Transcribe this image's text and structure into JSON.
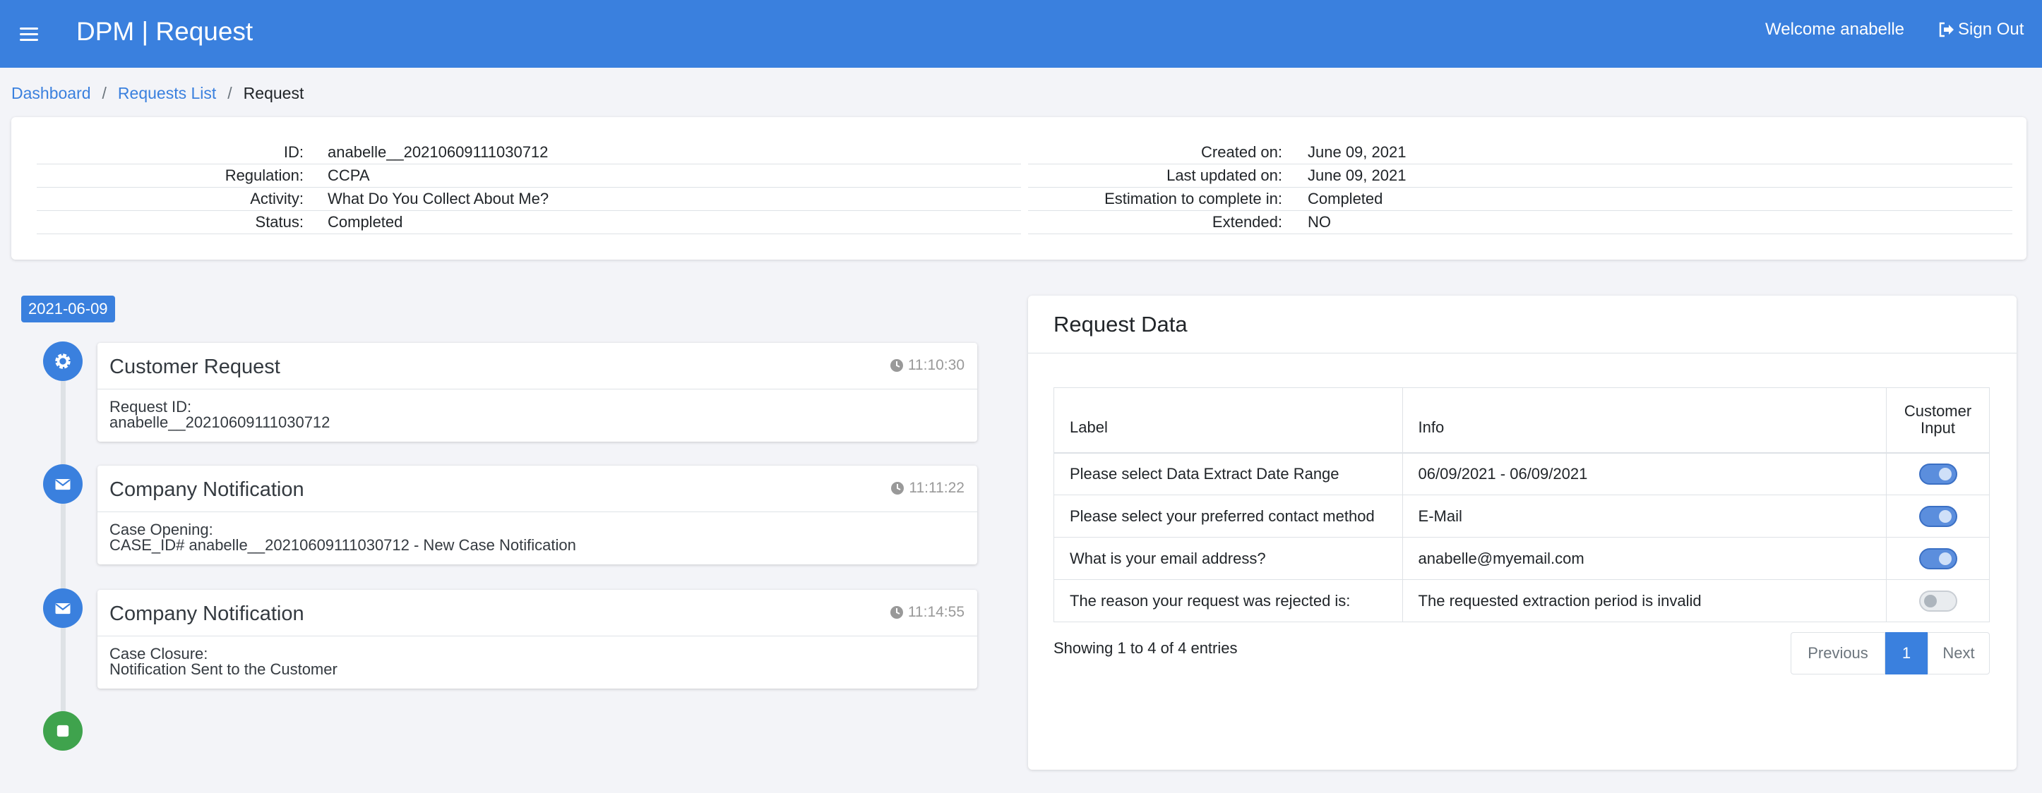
{
  "header": {
    "app_title": "DPM | Request",
    "welcome": "Welcome anabelle",
    "sign_out": "Sign Out"
  },
  "breadcrumb": {
    "dashboard": "Dashboard",
    "requests_list": "Requests List",
    "current": "Request",
    "separator": "/"
  },
  "info": {
    "left": [
      {
        "label": "ID:",
        "value": "anabelle__20210609111030712"
      },
      {
        "label": "Regulation:",
        "value": "CCPA"
      },
      {
        "label": "Activity:",
        "value": "What Do You Collect About Me?"
      },
      {
        "label": "Status:",
        "value": "Completed"
      }
    ],
    "right": [
      {
        "label": "Created on:",
        "value": "June 09, 2021"
      },
      {
        "label": "Last updated on:",
        "value": "June 09, 2021"
      },
      {
        "label": "Estimation to complete in:",
        "value": "Completed"
      },
      {
        "label": "Extended:",
        "value": "NO"
      }
    ]
  },
  "timeline": {
    "date": "2021-06-09",
    "items": [
      {
        "icon": "gear-icon",
        "title": "Customer Request",
        "time": "11:10:30",
        "line1": "Request ID:",
        "line2": "anabelle__20210609111030712"
      },
      {
        "icon": "envelope-icon",
        "title": "Company Notification",
        "time": "11:11:22",
        "line1": "Case Opening:",
        "line2": "CASE_ID# anabelle__20210609111030712 - New Case Notification"
      },
      {
        "icon": "envelope-icon",
        "title": "Company Notification",
        "time": "11:14:55",
        "line1": "Case Closure:",
        "line2": "Notification Sent to the Customer"
      }
    ],
    "end_icon": "stop-icon"
  },
  "request_data": {
    "title": "Request Data",
    "columns": [
      "Label",
      "Info",
      "Customer Input"
    ],
    "rows": [
      {
        "label": "Please select Data Extract Date Range",
        "info": "06/09/2021 - 06/09/2021",
        "customer_input": true
      },
      {
        "label": "Please select your preferred contact method",
        "info": "E-Mail",
        "customer_input": true
      },
      {
        "label": "What is your email address?",
        "info": "anabelle@myemail.com",
        "customer_input": true
      },
      {
        "label": "The reason your request was rejected is:",
        "info": "The requested extraction period is invalid",
        "customer_input": false
      }
    ],
    "showing": "Showing 1 to 4 of 4 entries",
    "pagination": {
      "previous": "Previous",
      "page": "1",
      "next": "Next"
    }
  },
  "colors": {
    "primary": "#3a80de",
    "success": "#3fa34d",
    "background": "#f3f4f8"
  }
}
